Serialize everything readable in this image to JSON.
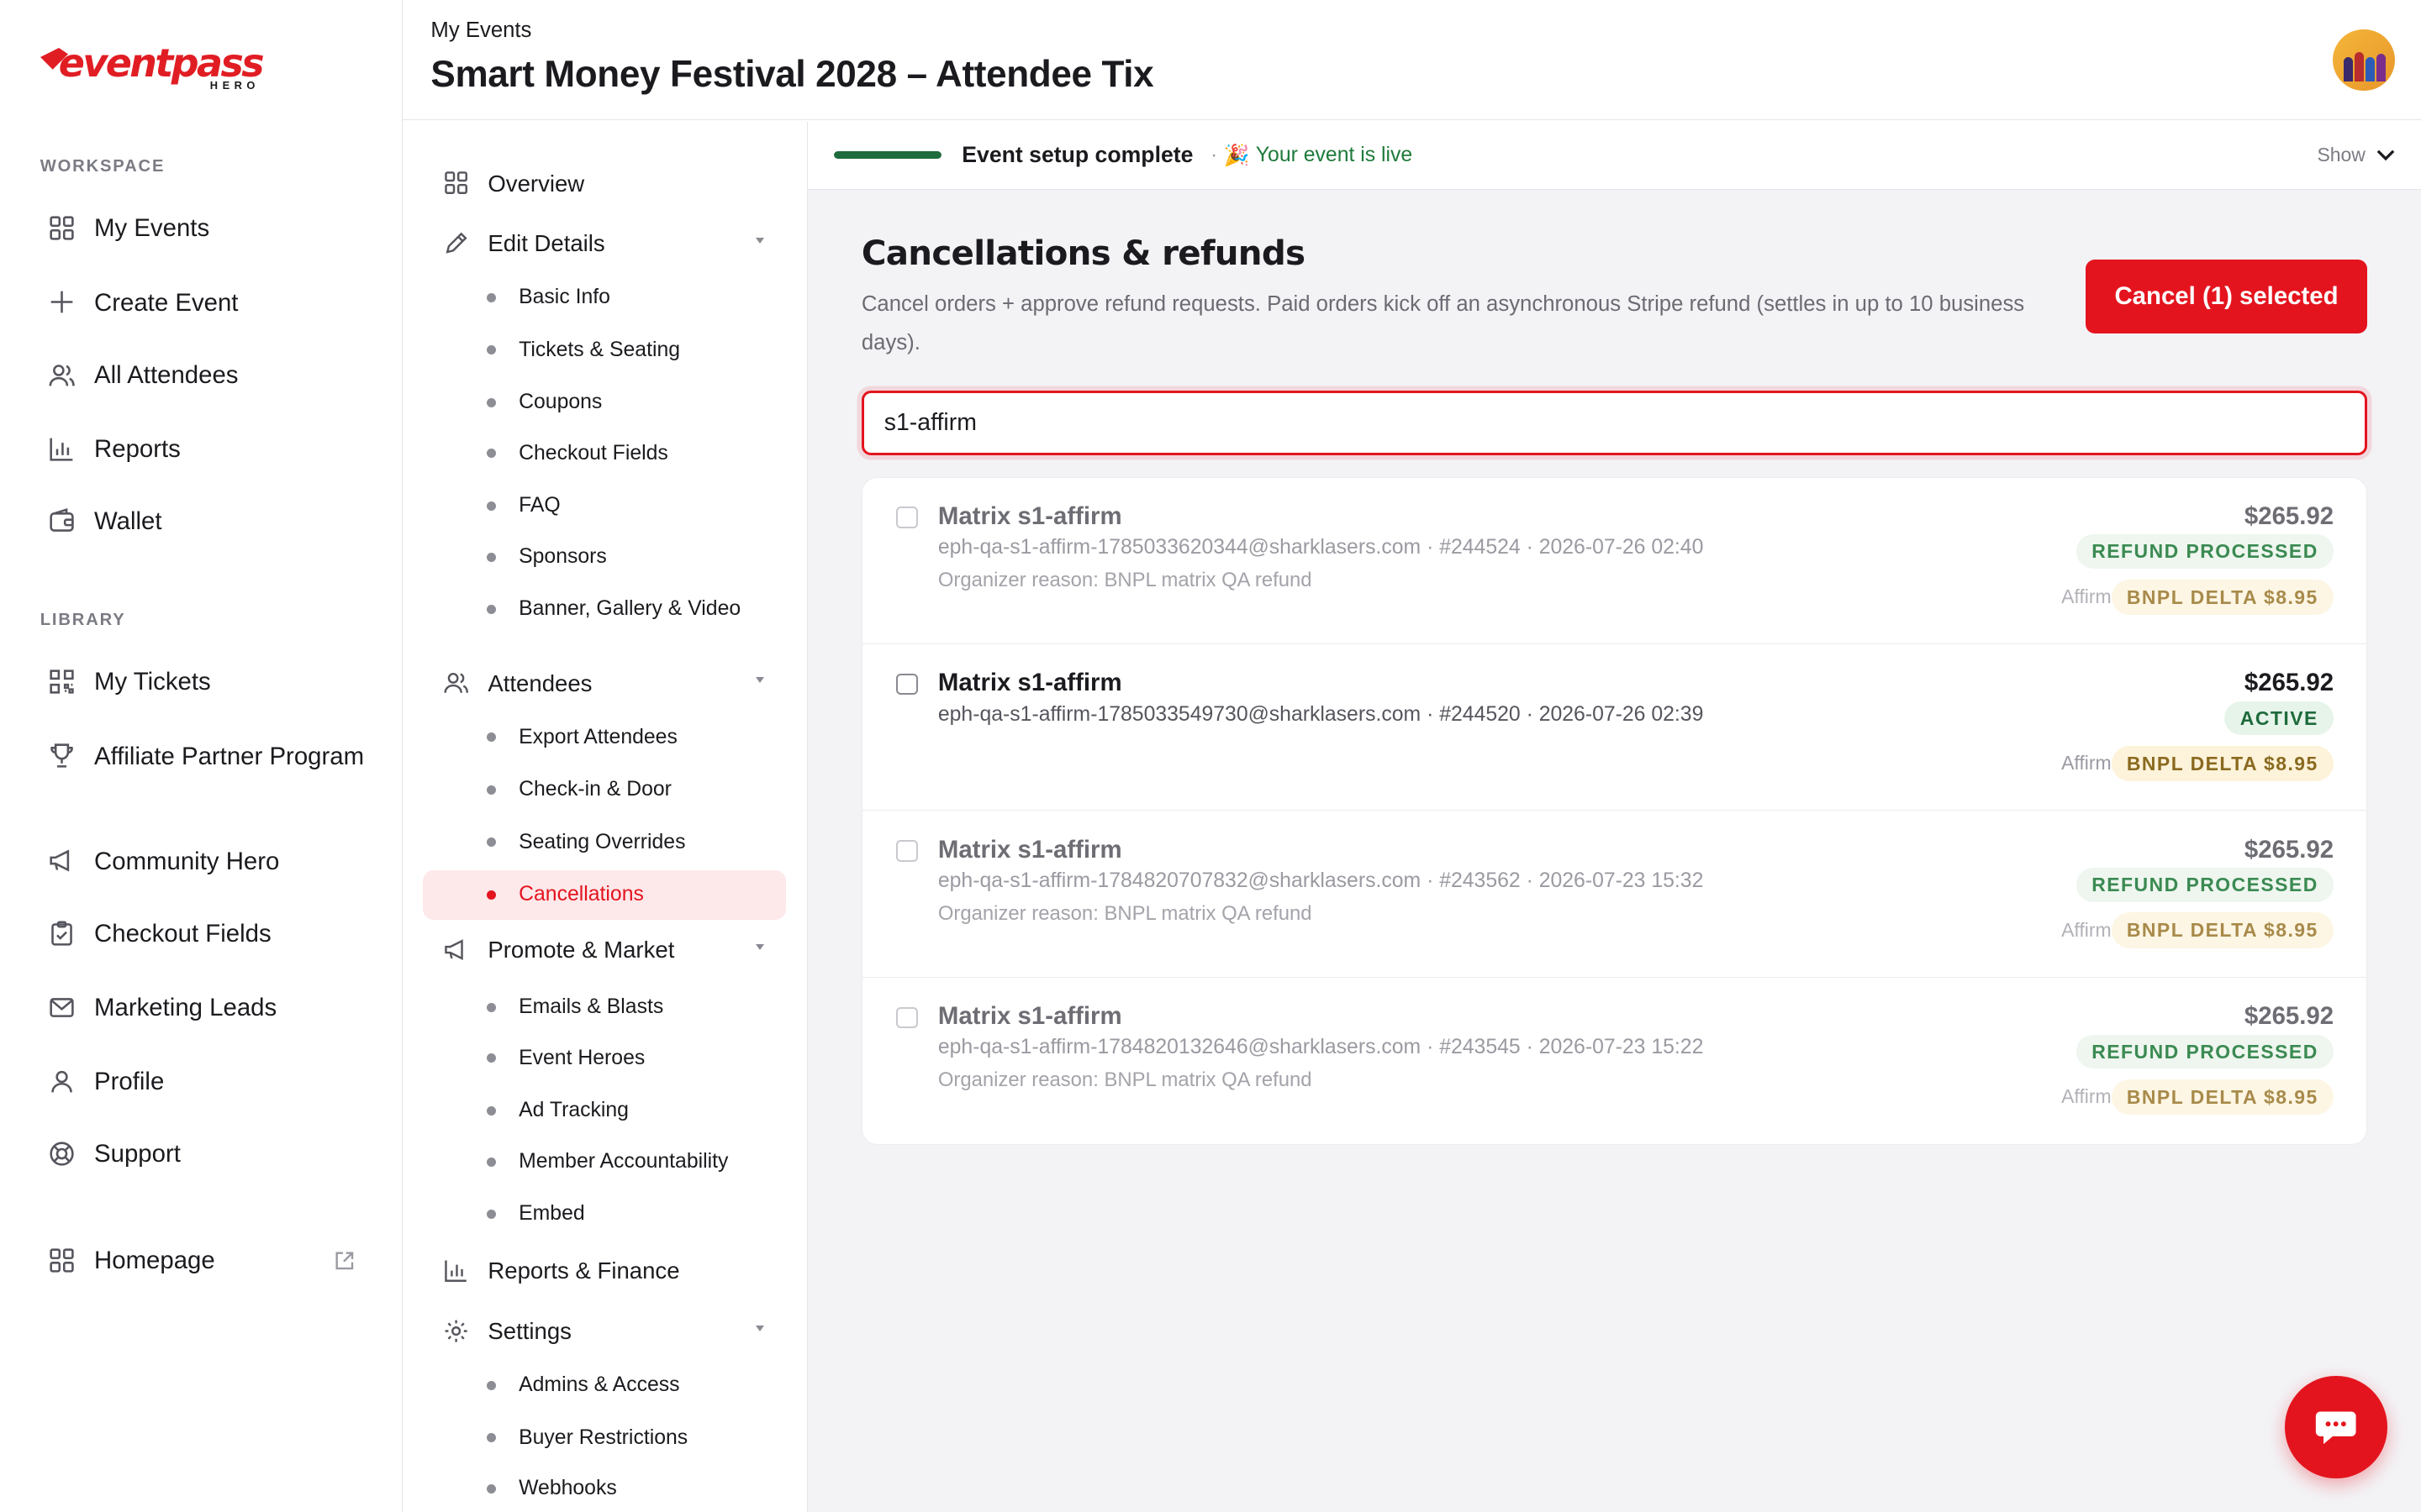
{
  "brand": {
    "logo_main": "eventpass",
    "logo_sub": "HERO",
    "accent": "#e4141e"
  },
  "sidebar": {
    "workspace_label": "WORKSPACE",
    "library_label": "LIBRARY",
    "workspace_items": [
      {
        "label": "My Events",
        "icon": "grid-icon"
      },
      {
        "label": "Create Event",
        "icon": "plus-icon"
      },
      {
        "label": "All Attendees",
        "icon": "users-icon"
      },
      {
        "label": "Reports",
        "icon": "bar-chart-icon"
      },
      {
        "label": "Wallet",
        "icon": "wallet-icon"
      }
    ],
    "library_items": [
      {
        "label": "My Tickets",
        "icon": "qr-code-icon"
      },
      {
        "label": "Affiliate Partner Program",
        "icon": "trophy-icon"
      },
      {
        "label": "Community Hero",
        "icon": "megaphone-icon"
      },
      {
        "label": "Checkout Fields",
        "icon": "clipboard-icon"
      },
      {
        "label": "Marketing Leads",
        "icon": "mail-icon"
      },
      {
        "label": "Profile",
        "icon": "user-icon"
      },
      {
        "label": "Support",
        "icon": "lifebuoy-icon"
      }
    ],
    "homepage": {
      "label": "Homepage",
      "icon": "grid-icon"
    }
  },
  "header": {
    "breadcrumb": "My Events",
    "title": "Smart Money Festival 2028 – Attendee Tix"
  },
  "event_nav": {
    "overview": "Overview",
    "edit_details": {
      "label": "Edit Details",
      "items": [
        "Basic Info",
        "Tickets & Seating",
        "Coupons",
        "Checkout Fields",
        "FAQ",
        "Sponsors",
        "Banner, Gallery & Video"
      ]
    },
    "attendees": {
      "label": "Attendees",
      "items": [
        "Export Attendees",
        "Check-in & Door",
        "Seating Overrides",
        "Cancellations"
      ]
    },
    "promote": {
      "label": "Promote & Market",
      "items": [
        "Emails & Blasts",
        "Event Heroes",
        "Ad Tracking",
        "Member Accountability",
        "Embed"
      ]
    },
    "reports": "Reports & Finance",
    "settings": {
      "label": "Settings",
      "items": [
        "Admins & Access",
        "Buyer Restrictions",
        "Webhooks"
      ]
    }
  },
  "setup": {
    "progress": 1.0,
    "label": "Event setup complete",
    "live_emoji": "🎉",
    "live_text": "Your event is live",
    "show_label": "Show"
  },
  "main": {
    "title": "Cancellations & refunds",
    "description": "Cancel orders + approve refund requests. Paid orders kick off an asynchronous Stripe refund (settles in up to 10 business days).",
    "cancel_button": "Cancel (1) selected",
    "search_value": "s1-affirm"
  },
  "orders": [
    {
      "name": "Matrix s1-affirm",
      "meta": "eph-qa-s1-affirm-1785033620344@sharklasers.com · #244524 · 2026-07-26 02:40",
      "reason": "Organizer reason: BNPL matrix QA refund",
      "amount": "$265.92",
      "status": "REFUND PROCESSED",
      "provider": "Affirm",
      "bnpl": "BNPL DELTA $8.95"
    },
    {
      "name": "Matrix s1-affirm",
      "meta": "eph-qa-s1-affirm-1785033549730@sharklasers.com · #244520 · 2026-07-26 02:39",
      "reason": "",
      "amount": "$265.92",
      "status": "ACTIVE",
      "provider": "Affirm",
      "bnpl": "BNPL DELTA $8.95"
    },
    {
      "name": "Matrix s1-affirm",
      "meta": "eph-qa-s1-affirm-1784820707832@sharklasers.com · #243562 · 2026-07-23 15:32",
      "reason": "Organizer reason: BNPL matrix QA refund",
      "amount": "$265.92",
      "status": "REFUND PROCESSED",
      "provider": "Affirm",
      "bnpl": "BNPL DELTA $8.95"
    },
    {
      "name": "Matrix s1-affirm",
      "meta": "eph-qa-s1-affirm-1784820132646@sharklasers.com · #243545 · 2026-07-23 15:22",
      "reason": "Organizer reason: BNPL matrix QA refund",
      "amount": "$265.92",
      "status": "REFUND PROCESSED",
      "provider": "Affirm",
      "bnpl": "BNPL DELTA $8.95"
    }
  ]
}
